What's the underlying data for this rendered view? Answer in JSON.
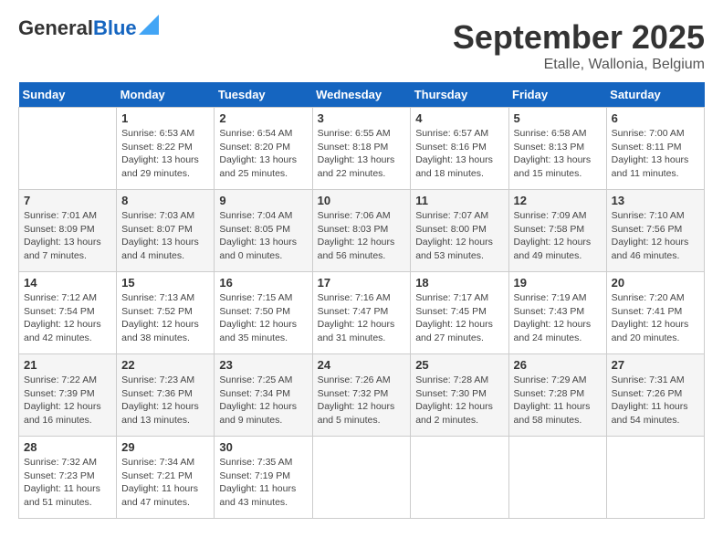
{
  "header": {
    "logo_line1": "General",
    "logo_line2": "Blue",
    "month": "September 2025",
    "location": "Etalle, Wallonia, Belgium"
  },
  "days_of_week": [
    "Sunday",
    "Monday",
    "Tuesday",
    "Wednesday",
    "Thursday",
    "Friday",
    "Saturday"
  ],
  "weeks": [
    [
      {
        "day": "",
        "info": ""
      },
      {
        "day": "1",
        "info": "Sunrise: 6:53 AM\nSunset: 8:22 PM\nDaylight: 13 hours\nand 29 minutes."
      },
      {
        "day": "2",
        "info": "Sunrise: 6:54 AM\nSunset: 8:20 PM\nDaylight: 13 hours\nand 25 minutes."
      },
      {
        "day": "3",
        "info": "Sunrise: 6:55 AM\nSunset: 8:18 PM\nDaylight: 13 hours\nand 22 minutes."
      },
      {
        "day": "4",
        "info": "Sunrise: 6:57 AM\nSunset: 8:16 PM\nDaylight: 13 hours\nand 18 minutes."
      },
      {
        "day": "5",
        "info": "Sunrise: 6:58 AM\nSunset: 8:13 PM\nDaylight: 13 hours\nand 15 minutes."
      },
      {
        "day": "6",
        "info": "Sunrise: 7:00 AM\nSunset: 8:11 PM\nDaylight: 13 hours\nand 11 minutes."
      }
    ],
    [
      {
        "day": "7",
        "info": "Sunrise: 7:01 AM\nSunset: 8:09 PM\nDaylight: 13 hours\nand 7 minutes."
      },
      {
        "day": "8",
        "info": "Sunrise: 7:03 AM\nSunset: 8:07 PM\nDaylight: 13 hours\nand 4 minutes."
      },
      {
        "day": "9",
        "info": "Sunrise: 7:04 AM\nSunset: 8:05 PM\nDaylight: 13 hours\nand 0 minutes."
      },
      {
        "day": "10",
        "info": "Sunrise: 7:06 AM\nSunset: 8:03 PM\nDaylight: 12 hours\nand 56 minutes."
      },
      {
        "day": "11",
        "info": "Sunrise: 7:07 AM\nSunset: 8:00 PM\nDaylight: 12 hours\nand 53 minutes."
      },
      {
        "day": "12",
        "info": "Sunrise: 7:09 AM\nSunset: 7:58 PM\nDaylight: 12 hours\nand 49 minutes."
      },
      {
        "day": "13",
        "info": "Sunrise: 7:10 AM\nSunset: 7:56 PM\nDaylight: 12 hours\nand 46 minutes."
      }
    ],
    [
      {
        "day": "14",
        "info": "Sunrise: 7:12 AM\nSunset: 7:54 PM\nDaylight: 12 hours\nand 42 minutes."
      },
      {
        "day": "15",
        "info": "Sunrise: 7:13 AM\nSunset: 7:52 PM\nDaylight: 12 hours\nand 38 minutes."
      },
      {
        "day": "16",
        "info": "Sunrise: 7:15 AM\nSunset: 7:50 PM\nDaylight: 12 hours\nand 35 minutes."
      },
      {
        "day": "17",
        "info": "Sunrise: 7:16 AM\nSunset: 7:47 PM\nDaylight: 12 hours\nand 31 minutes."
      },
      {
        "day": "18",
        "info": "Sunrise: 7:17 AM\nSunset: 7:45 PM\nDaylight: 12 hours\nand 27 minutes."
      },
      {
        "day": "19",
        "info": "Sunrise: 7:19 AM\nSunset: 7:43 PM\nDaylight: 12 hours\nand 24 minutes."
      },
      {
        "day": "20",
        "info": "Sunrise: 7:20 AM\nSunset: 7:41 PM\nDaylight: 12 hours\nand 20 minutes."
      }
    ],
    [
      {
        "day": "21",
        "info": "Sunrise: 7:22 AM\nSunset: 7:39 PM\nDaylight: 12 hours\nand 16 minutes."
      },
      {
        "day": "22",
        "info": "Sunrise: 7:23 AM\nSunset: 7:36 PM\nDaylight: 12 hours\nand 13 minutes."
      },
      {
        "day": "23",
        "info": "Sunrise: 7:25 AM\nSunset: 7:34 PM\nDaylight: 12 hours\nand 9 minutes."
      },
      {
        "day": "24",
        "info": "Sunrise: 7:26 AM\nSunset: 7:32 PM\nDaylight: 12 hours\nand 5 minutes."
      },
      {
        "day": "25",
        "info": "Sunrise: 7:28 AM\nSunset: 7:30 PM\nDaylight: 12 hours\nand 2 minutes."
      },
      {
        "day": "26",
        "info": "Sunrise: 7:29 AM\nSunset: 7:28 PM\nDaylight: 11 hours\nand 58 minutes."
      },
      {
        "day": "27",
        "info": "Sunrise: 7:31 AM\nSunset: 7:26 PM\nDaylight: 11 hours\nand 54 minutes."
      }
    ],
    [
      {
        "day": "28",
        "info": "Sunrise: 7:32 AM\nSunset: 7:23 PM\nDaylight: 11 hours\nand 51 minutes."
      },
      {
        "day": "29",
        "info": "Sunrise: 7:34 AM\nSunset: 7:21 PM\nDaylight: 11 hours\nand 47 minutes."
      },
      {
        "day": "30",
        "info": "Sunrise: 7:35 AM\nSunset: 7:19 PM\nDaylight: 11 hours\nand 43 minutes."
      },
      {
        "day": "",
        "info": ""
      },
      {
        "day": "",
        "info": ""
      },
      {
        "day": "",
        "info": ""
      },
      {
        "day": "",
        "info": ""
      }
    ]
  ]
}
